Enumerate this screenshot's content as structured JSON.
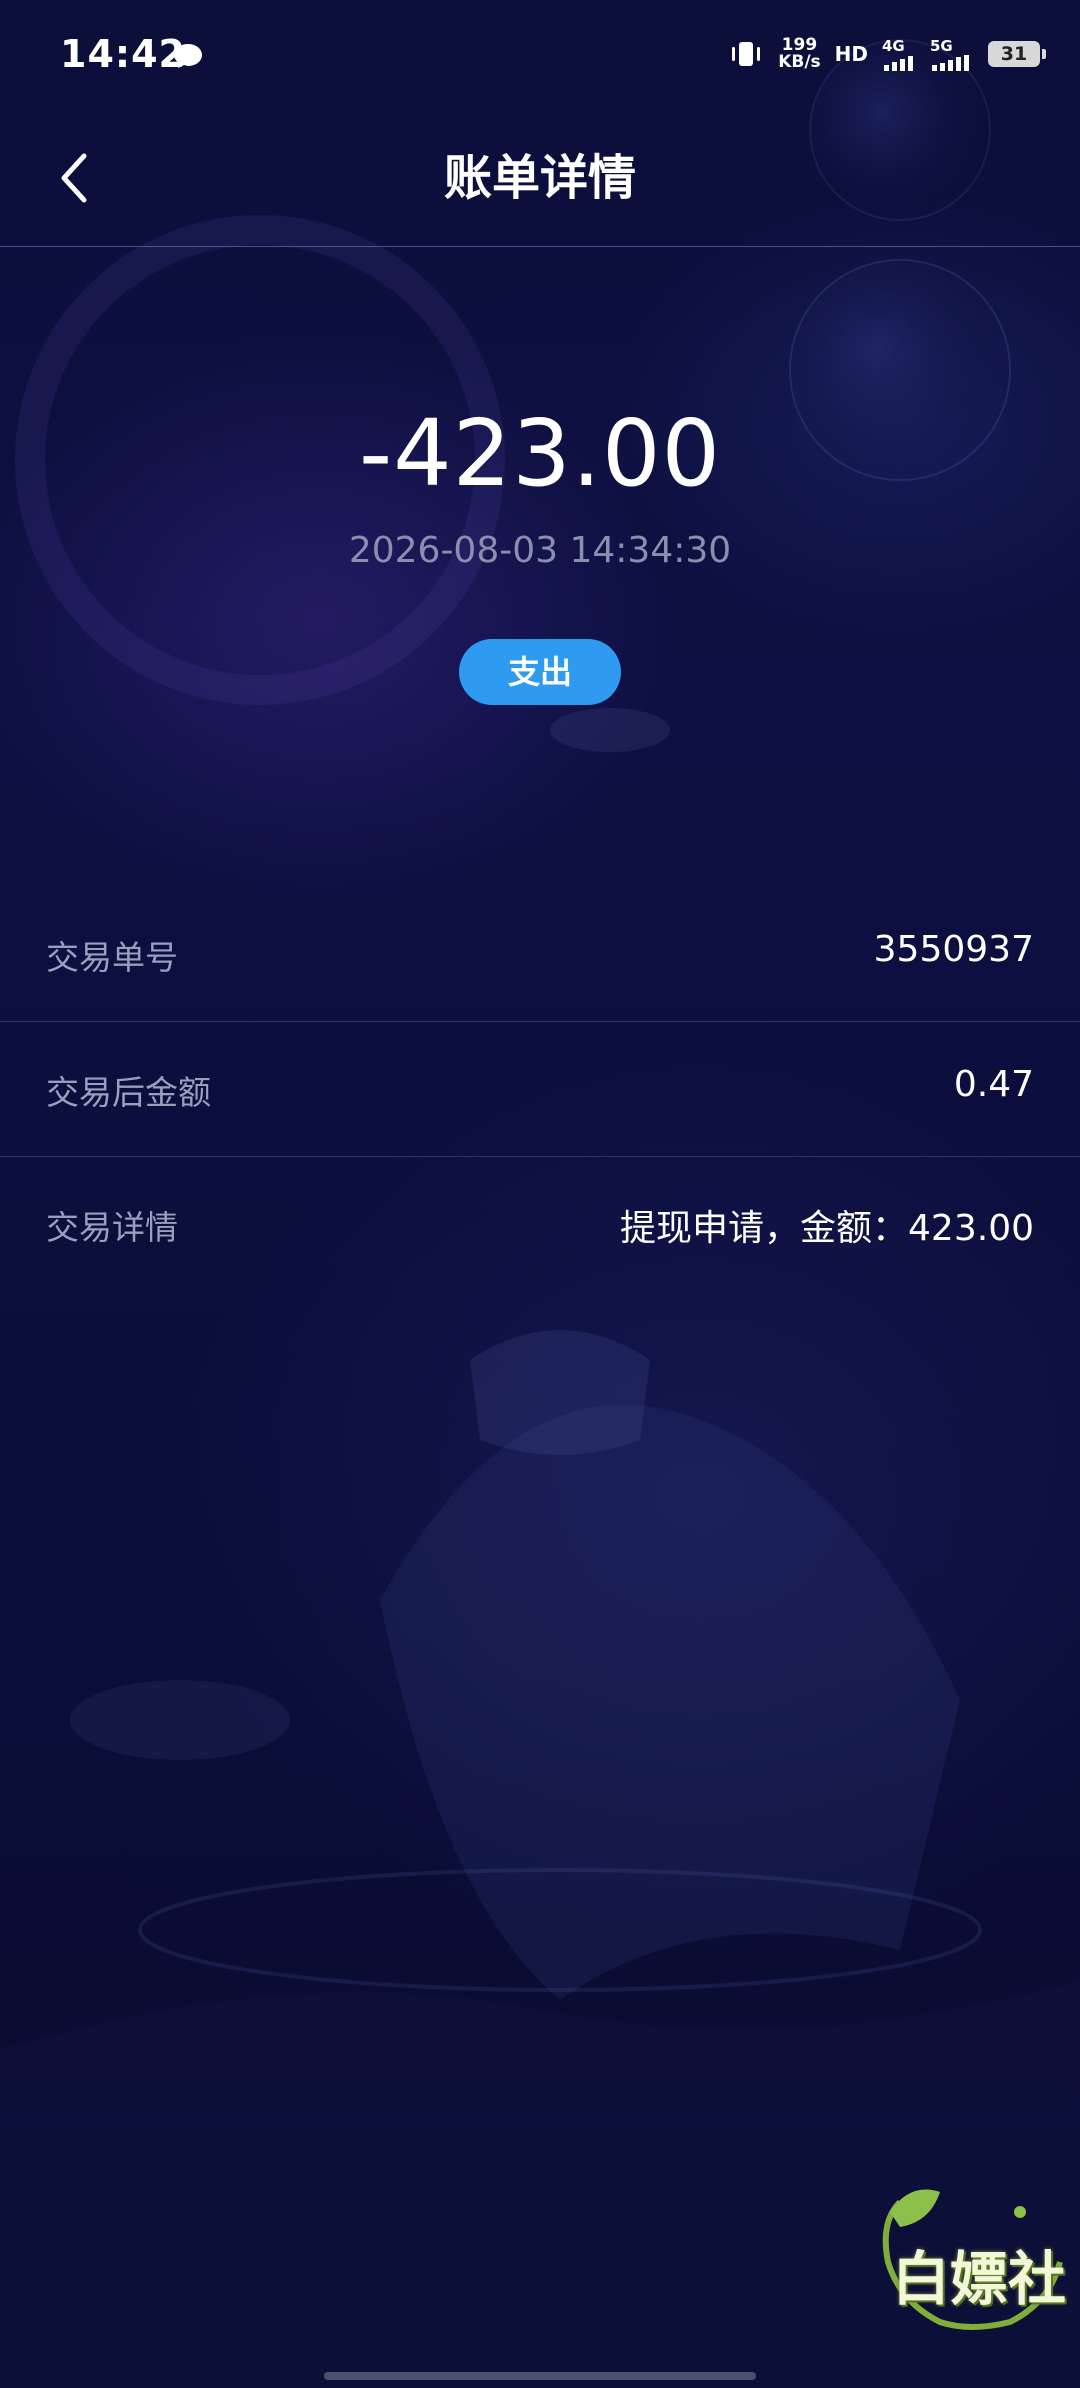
{
  "status_bar": {
    "time": "14:42",
    "net_speed_value": "199",
    "net_speed_unit": "KB/s",
    "hd_label": "HD",
    "signal_1_label": "4G",
    "signal_2_label": "5G",
    "battery_level": "31",
    "icons": [
      "chat-bubble-icon",
      "vibrate-icon",
      "signal-icon",
      "battery-icon"
    ]
  },
  "header": {
    "title": "账单详情",
    "back_icon": "chevron-left-icon"
  },
  "summary": {
    "amount": "-423.00",
    "datetime": "2026-08-03 14:34:30",
    "type_label": "支出",
    "type_color": "#2e9bf0"
  },
  "details": [
    {
      "label": "交易单号",
      "value": "3550937"
    },
    {
      "label": "交易后金额",
      "value": "0.47"
    },
    {
      "label": "交易详情",
      "value": "提现申请，金额：423.00"
    }
  ],
  "watermark": {
    "text": "白嫖社"
  }
}
